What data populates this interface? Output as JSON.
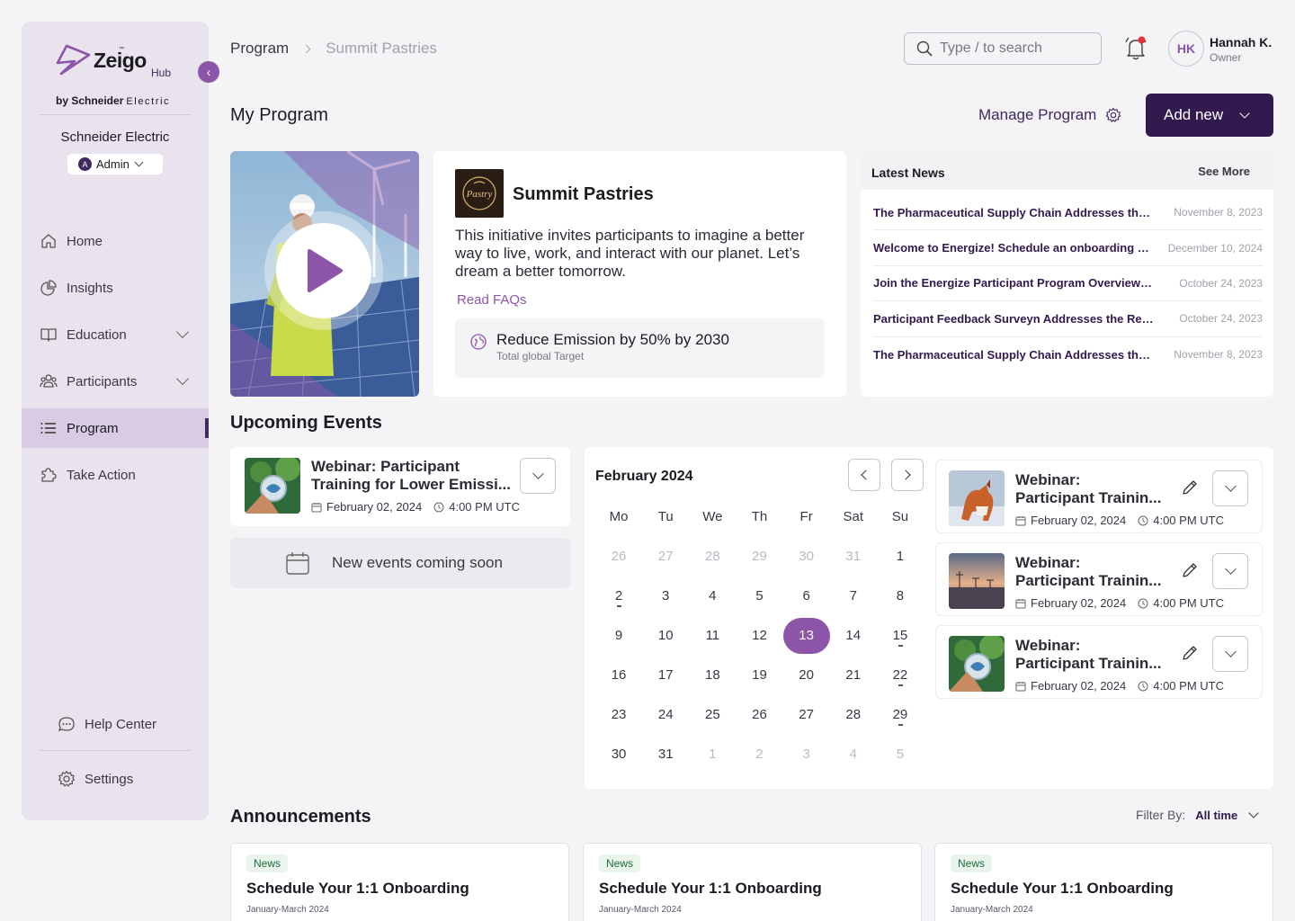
{
  "brand": {
    "word": "Zeigo",
    "tm": "™",
    "hub": "Hub",
    "by": "by Schneider",
    "electric": "Electric",
    "org": "Schneider Electric",
    "role_initial": "A",
    "role": "Admin"
  },
  "nav": {
    "items": [
      {
        "label": "Home",
        "icon": "home-icon"
      },
      {
        "label": "Insights",
        "icon": "pie-chart-icon"
      },
      {
        "label": "Education",
        "icon": "book-icon",
        "expandable": true
      },
      {
        "label": "Participants",
        "icon": "users-icon",
        "expandable": true
      },
      {
        "label": "Program",
        "icon": "list-icon",
        "active": true
      },
      {
        "label": "Take Action",
        "icon": "puzzle-icon"
      }
    ],
    "help": "Help Center",
    "settings": "Settings"
  },
  "header": {
    "breadcrumb": [
      "Program",
      "Summit Pastries"
    ],
    "search_placeholder": "Type / to search",
    "user_initials": "HK",
    "user_name": "Hannah K.",
    "user_role": "Owner"
  },
  "page": {
    "title": "My Program",
    "manage_label": "Manage Program",
    "add_new_label": "Add new"
  },
  "program": {
    "logo_text": "Pastry",
    "name": "Summit Pastries",
    "description": "This initiative invites participants to imagine a better way to live, work, and interact with our planet. Let’s dream a better tomorrow.",
    "faq_label": "Read FAQs",
    "target_title": "Reduce Emission by 50% by 2030",
    "target_sub": "Total global Target"
  },
  "news": {
    "title": "Latest News",
    "see_more": "See More",
    "items": [
      {
        "text": "The Pharmaceutical Supply Chain Addresses the Need for Greater Sustainability",
        "date": "November 8, 2023"
      },
      {
        "text": "Welcome to Energize! Schedule an onboarding call",
        "date": "December 10, 2024"
      },
      {
        "text": "Join the Energize Participant Program Overview And Demo",
        "date": "October 24, 2023"
      },
      {
        "text": "Participant Feedback Surveyn Addresses the Renewable Energy",
        "date": "October 24, 2023"
      },
      {
        "text": "The Pharmaceutical Supply Chain Addresses the Need for Greater Sustainability",
        "date": "November 8, 2023"
      }
    ]
  },
  "events": {
    "title": "Upcoming Events",
    "main": {
      "title": "Webinar: Participant Training for Lower Emissi...",
      "date": "February 02, 2024",
      "time": "4:00 PM UTC"
    },
    "soon": "New events coming soon",
    "calendar": {
      "month": "February 2024",
      "weekdays": [
        "Mo",
        "Tu",
        "We",
        "Th",
        "Fr",
        "Sat",
        "Su"
      ],
      "weeks": [
        [
          [
            "26",
            1
          ],
          [
            "27",
            1
          ],
          [
            "28",
            1
          ],
          [
            "29",
            1
          ],
          [
            "30",
            1
          ],
          [
            "31",
            1
          ],
          [
            "1",
            0
          ]
        ],
        [
          [
            "2",
            0,
            1
          ],
          [
            "3",
            0
          ],
          [
            "4",
            0
          ],
          [
            "5",
            0
          ],
          [
            "6",
            0
          ],
          [
            "7",
            0
          ],
          [
            "8",
            0
          ]
        ],
        [
          [
            "9",
            0
          ],
          [
            "10",
            0
          ],
          [
            "11",
            0
          ],
          [
            "12",
            0
          ],
          [
            "13",
            0,
            0,
            1
          ],
          [
            "14",
            0
          ],
          [
            "15",
            0,
            1
          ]
        ],
        [
          [
            "16",
            0
          ],
          [
            "17",
            0
          ],
          [
            "18",
            0
          ],
          [
            "19",
            0
          ],
          [
            "20",
            0
          ],
          [
            "21",
            0
          ],
          [
            "22",
            0,
            1
          ]
        ],
        [
          [
            "23",
            0
          ],
          [
            "24",
            0
          ],
          [
            "25",
            0
          ],
          [
            "26",
            0
          ],
          [
            "27",
            0
          ],
          [
            "28",
            0
          ],
          [
            "29",
            0,
            1
          ]
        ],
        [
          [
            "30",
            0
          ],
          [
            "31",
            0
          ],
          [
            "1",
            1
          ],
          [
            "2",
            1
          ],
          [
            "3",
            1
          ],
          [
            "4",
            1
          ],
          [
            "5",
            1
          ]
        ]
      ]
    },
    "side": [
      {
        "title1": "Webinar:",
        "title2": "Participant Trainin...",
        "date": "February 02, 2024",
        "time": "4:00 PM UTC"
      },
      {
        "title1": "Webinar:",
        "title2": "Participant Trainin...",
        "date": "February 02, 2024",
        "time": "4:00 PM UTC"
      },
      {
        "title1": "Webinar:",
        "title2": "Participant Trainin...",
        "date": "February 02, 2024",
        "time": "4:00 PM UTC"
      }
    ]
  },
  "announcements": {
    "title": "Announcements",
    "filter_label": "Filter By:",
    "filter_value": "All time",
    "items": [
      {
        "tag": "News",
        "title": "Schedule Your 1:1 Onboarding",
        "date": "January-March 2024"
      },
      {
        "tag": "News",
        "title": "Schedule Your 1:1 Onboarding",
        "date": "January-March 2024"
      },
      {
        "tag": "News",
        "title": "Schedule Your 1:1 Onboarding",
        "date": "January-March 2024"
      }
    ]
  },
  "colors": {
    "accent": "#8d55a8",
    "primary_dark": "#32194e",
    "sidebar_bg": "#e9e3ee",
    "news_text": "#32194e",
    "tag_bg": "#eaf5ec"
  }
}
